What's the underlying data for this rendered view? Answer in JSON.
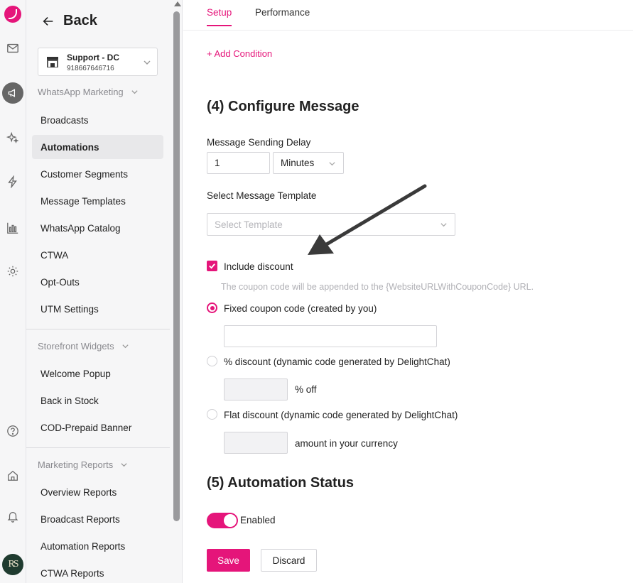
{
  "sidebar": {
    "back_label": "Back",
    "store": {
      "name": "Support - DC",
      "phone": "918667646716"
    },
    "sections": [
      {
        "title": "WhatsApp Marketing",
        "items": [
          "Broadcasts",
          "Automations",
          "Customer Segments",
          "Message Templates",
          "WhatsApp Catalog",
          "CTWA",
          "Opt-Outs",
          "UTM Settings"
        ]
      },
      {
        "title": "Storefront Widgets",
        "items": [
          "Welcome Popup",
          "Back in Stock",
          "COD-Prepaid Banner"
        ]
      },
      {
        "title": "Marketing Reports",
        "items": [
          "Overview Reports",
          "Broadcast Reports",
          "Automation Reports",
          "CTWA Reports"
        ]
      }
    ],
    "active_item": "Automations"
  },
  "rail": {
    "avatar_initials": "RS",
    "icons": [
      "logo-icon",
      "inbox-icon",
      "megaphone-icon",
      "sparkle-icon",
      "lightning-icon",
      "chart-icon",
      "settings-icon",
      "help-icon",
      "home-icon",
      "bell-icon"
    ]
  },
  "tabs": [
    {
      "label": "Setup",
      "active": true
    },
    {
      "label": "Performance",
      "active": false
    }
  ],
  "main": {
    "add_condition": "+ Add Condition",
    "configure_title": "(4) Configure Message",
    "delay_label": "Message Sending Delay",
    "delay_value": "1",
    "delay_unit": "Minutes",
    "template_label": "Select Message Template",
    "template_placeholder": "Select Template",
    "include_discount_label": "Include discount",
    "include_discount_checked": true,
    "coupon_hint": "The coupon code will be appended to the {WebsiteURLWithCouponCode} URL.",
    "options": [
      {
        "label": "Fixed coupon code (created by you)",
        "selected": true
      },
      {
        "label": "% discount (dynamic code generated by DelightChat)",
        "selected": false,
        "suffix": "% off"
      },
      {
        "label": "Flat discount (dynamic code generated by DelightChat)",
        "selected": false,
        "suffix": "amount in your currency"
      }
    ],
    "status_title": "(5) Automation Status",
    "status_label": "Enabled",
    "status_enabled": true,
    "save_label": "Save",
    "discard_label": "Discard"
  },
  "colors": {
    "accent": "#e5157a",
    "sidebar_bg": "#f6f6f7",
    "active_item_bg": "#e8e8ea"
  }
}
